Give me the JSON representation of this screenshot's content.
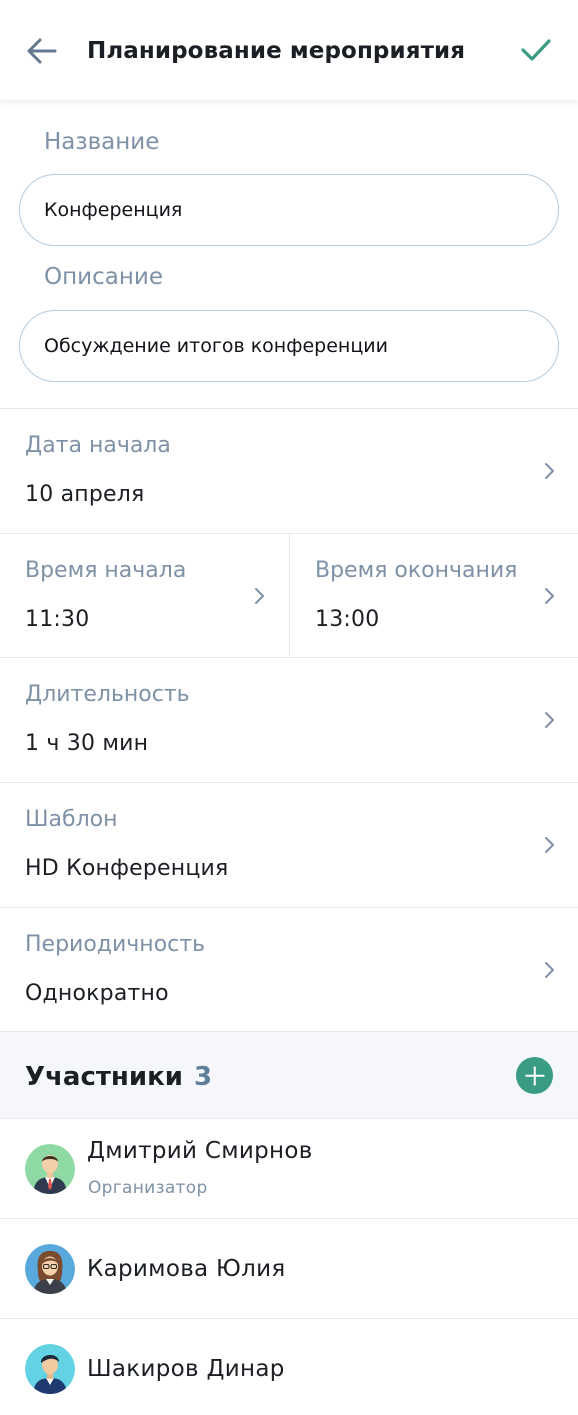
{
  "header": {
    "title": "Планирование мероприятия",
    "back_icon": "arrow-left-icon",
    "confirm_icon": "checkmark-icon"
  },
  "form": {
    "name_label": "Название",
    "name_value": "Конференция",
    "description_label": "Описание",
    "description_value": "Обсуждение итогов конференции"
  },
  "fields": {
    "start_date": {
      "label": "Дата начала",
      "value": "10 апреля"
    },
    "start_time": {
      "label": "Время начала",
      "value": "11:30"
    },
    "end_time": {
      "label": "Время окончания",
      "value": "13:00"
    },
    "duration": {
      "label": "Длительность",
      "value": "1 ч 30 мин"
    },
    "template": {
      "label": "Шаблон",
      "value": "HD Конференция"
    },
    "recurrence": {
      "label": "Периодичность",
      "value": "Однократно"
    }
  },
  "participants": {
    "title": "Участники",
    "count": "3",
    "add_icon": "plus-circle-icon",
    "items": [
      {
        "name": "Дмитрий Смирнов",
        "role": "Организатор",
        "avatar_color": "#8ed9a4"
      },
      {
        "name": "Каримова Юлия",
        "role": "",
        "avatar_color": "#5aa9dc"
      },
      {
        "name": "Шакиров Динар",
        "role": "",
        "avatar_color": "#63d2e3"
      }
    ]
  },
  "colors": {
    "accent": "#3a9c84",
    "label": "#7e91a6",
    "input_border": "#b5cbe0",
    "section_bg": "#f5f7fa"
  }
}
